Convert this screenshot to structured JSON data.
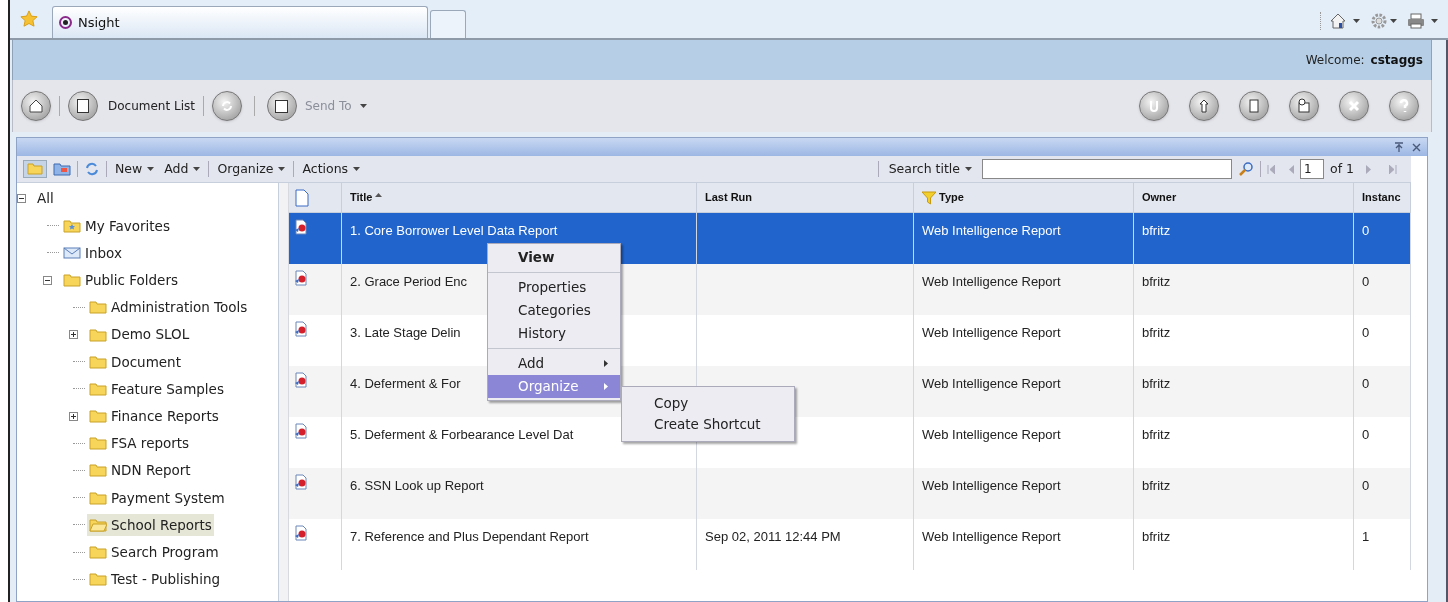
{
  "browser": {
    "tab_title": "Nsight"
  },
  "header": {
    "welcome_label": "Welcome:",
    "user": "cstaggs"
  },
  "main_toolbar": {
    "document_list": "Document List",
    "send_to": "Send To"
  },
  "list_toolbar": {
    "menus": [
      "New",
      "Add",
      "Organize",
      "Actions"
    ],
    "search_label": "Search title",
    "page": "1",
    "page_total": "of 1"
  },
  "tree": {
    "label": "All",
    "expanded": true,
    "selected": false,
    "children": [
      {
        "label": "My Favorites",
        "kind": "favorites",
        "selected": false
      },
      {
        "label": "Inbox",
        "kind": "inbox",
        "selected": false
      },
      {
        "label": "Public Folders",
        "kind": "folder",
        "expanded": true,
        "selected": false,
        "children": [
          {
            "label": "Administration Tools",
            "kind": "folder",
            "selected": false
          },
          {
            "label": "Demo SLOL",
            "kind": "folder",
            "expanded": false,
            "selected": false
          },
          {
            "label": "Document",
            "kind": "folder",
            "selected": false
          },
          {
            "label": "Feature Samples",
            "kind": "folder",
            "selected": false
          },
          {
            "label": "Finance Reports",
            "kind": "folder",
            "expanded": false,
            "selected": false
          },
          {
            "label": "FSA reports",
            "kind": "folder",
            "selected": false
          },
          {
            "label": "NDN Report",
            "kind": "folder",
            "selected": false
          },
          {
            "label": "Payment System",
            "kind": "folder",
            "selected": false
          },
          {
            "label": "School Reports",
            "kind": "folder",
            "selected": true
          },
          {
            "label": "Search Program",
            "kind": "folder",
            "selected": false
          },
          {
            "label": "Test - Publishing",
            "kind": "folder",
            "selected": false
          }
        ]
      }
    ]
  },
  "table": {
    "columns": [
      "Title",
      "Last Run",
      "Type",
      "Owner",
      "Instanc"
    ],
    "rows": [
      {
        "title": "1. Core Borrower Level Data Report",
        "last_run": "",
        "type": "Web Intelligence Report",
        "owner": "bfritz",
        "instances": "0",
        "selected": true
      },
      {
        "title": "2. Grace Period Enc",
        "last_run": "",
        "type": "Web Intelligence Report",
        "owner": "bfritz",
        "instances": "0",
        "selected": false
      },
      {
        "title": "3. Late Stage Delin",
        "last_run": "",
        "type": "Web Intelligence Report",
        "owner": "bfritz",
        "instances": "0",
        "selected": false
      },
      {
        "title": "4. Deferment & For",
        "last_run": "",
        "type": "Web Intelligence Report",
        "owner": "bfritz",
        "instances": "0",
        "selected": false
      },
      {
        "title": "5. Deferment & Forbearance Level Dat",
        "last_run": "",
        "type": "Web Intelligence Report",
        "owner": "bfritz",
        "instances": "0",
        "selected": false
      },
      {
        "title": "6. SSN Look up Report",
        "last_run": "",
        "type": "Web Intelligence Report",
        "owner": "bfritz",
        "instances": "0",
        "selected": false
      },
      {
        "title": "7. Reference and Plus Dependant Report",
        "last_run": "Sep 02, 2011 12:44 PM",
        "type": "Web Intelligence Report",
        "owner": "bfritz",
        "instances": "1",
        "selected": false
      }
    ]
  },
  "context_menu": {
    "items": [
      {
        "label": "View",
        "kind": "default",
        "submenu": false,
        "selected": false
      },
      {
        "kind": "separator"
      },
      {
        "label": "Properties",
        "kind": "item",
        "submenu": false,
        "selected": false
      },
      {
        "label": "Categories",
        "kind": "item",
        "submenu": false,
        "selected": false
      },
      {
        "label": "History",
        "kind": "item",
        "submenu": false,
        "selected": false
      },
      {
        "kind": "separator"
      },
      {
        "label": "Add",
        "kind": "item",
        "submenu": true,
        "selected": false
      },
      {
        "label": "Organize",
        "kind": "item",
        "submenu": true,
        "selected": true
      }
    ],
    "submenu": [
      "Copy",
      "Create Shortcut"
    ]
  }
}
